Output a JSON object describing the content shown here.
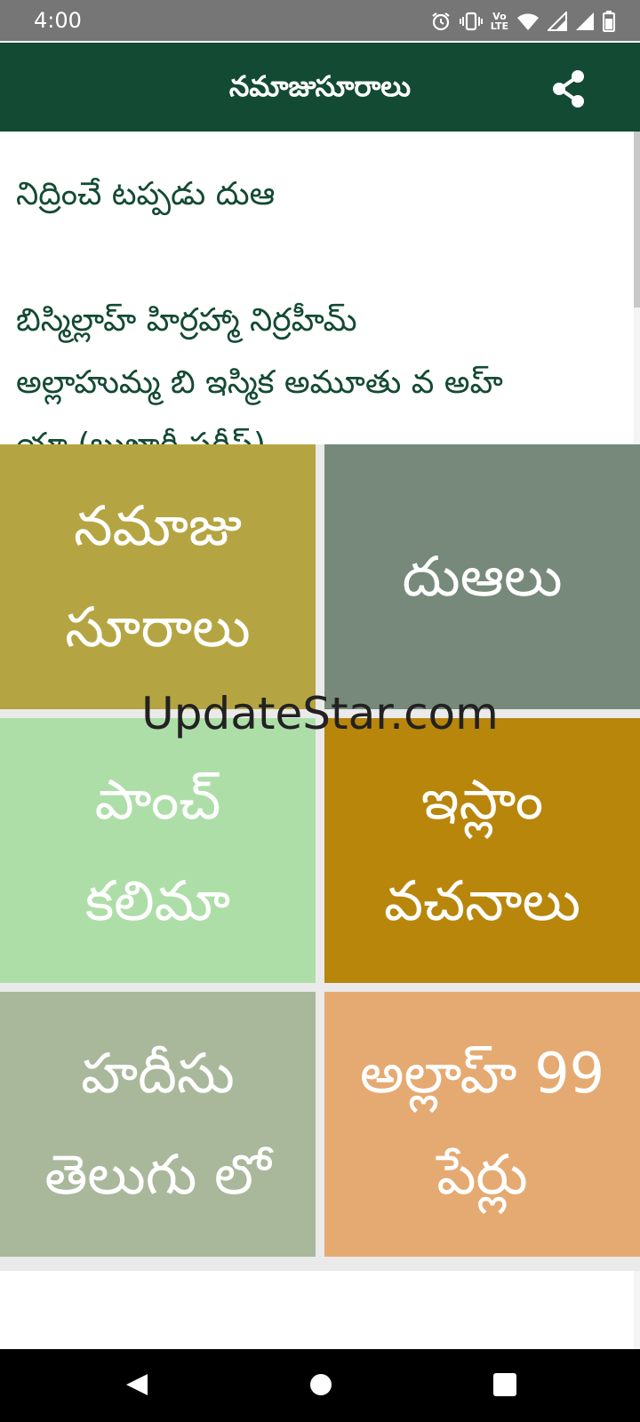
{
  "status_bar": {
    "time": "4:00",
    "icons": [
      "alarm-icon",
      "vibrate-icon",
      "volte-lte-icon",
      "wifi-icon",
      "signal-icon",
      "signal-icon-2",
      "battery-icon"
    ],
    "lte_top": "Vo",
    "lte_bottom": "LTE"
  },
  "app_bar": {
    "title": "నమాజుసూరాలు",
    "action_icon": "share-icon"
  },
  "content": {
    "title": "నిద్రించే టప్పడు దుఆ",
    "lines": [
      "బిస్మిల్లాహ్ హిర్రహ్మా నిర్రహీమ్",
      "అల్లాహుమ్మ బి ఇస్మిక అమూతు వ అహ్",
      "యా (బుఖారీ షరీఫ్)"
    ]
  },
  "tiles": [
    {
      "label": "నమాజు\nసూరాలు",
      "color": "#b5a542"
    },
    {
      "label": "దుఆలు",
      "color": "#76897a"
    },
    {
      "label": "పాంచ్\nకలిమా",
      "color": "#aedea8"
    },
    {
      "label": "ఇస్లాం\nవచనాలు",
      "color": "#b8860b"
    },
    {
      "label": "హదీసు\nతెలుగు లో",
      "color": "#a9b89b"
    },
    {
      "label": "అల్లాహ్ 99\nపేర్లు",
      "color": "#e5aa72"
    }
  ],
  "watermark": "UpdateStar.com",
  "nav_bar": {
    "icons": [
      "back-icon",
      "home-icon",
      "recents-icon"
    ]
  },
  "colors": {
    "app_bar": "#134a33",
    "status_bar": "#767676",
    "text_green": "#134a33"
  }
}
